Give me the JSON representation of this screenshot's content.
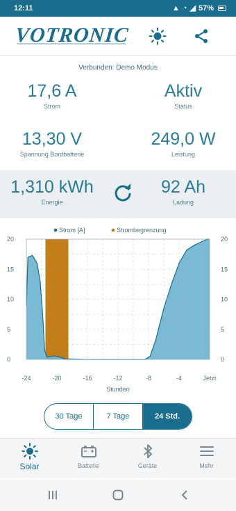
{
  "status_bar": {
    "time": "12:11",
    "battery": "57%"
  },
  "header": {
    "brand": "VOTRONIC"
  },
  "connection_text": "Verbunden: Demo Modus",
  "metrics": {
    "strom": {
      "value": "17,6 A",
      "label": "Strom"
    },
    "status": {
      "value": "Aktiv",
      "label": "Status"
    },
    "spannung": {
      "value": "13,30 V",
      "label": "Spannung Bordbatterie"
    },
    "leistung": {
      "value": "249,0 W",
      "label": "Leistung"
    },
    "energie": {
      "value": "1,310 kWh",
      "label": "Energie"
    },
    "ladung": {
      "value": "92 Ah",
      "label": "Ladung"
    }
  },
  "chart_data": {
    "type": "area",
    "legend": [
      {
        "name": "Strom [A]",
        "color": "#1a6d8d"
      },
      {
        "name": "Strombegrenzung",
        "color": "#c17d1a"
      }
    ],
    "xlabel": "Stunden",
    "x_ticks": [
      "-24",
      "-20",
      "-16",
      "-12",
      "-8",
      "-4",
      "Jetzt"
    ],
    "y_ticks": [
      "0",
      "5",
      "10",
      "15",
      "20"
    ],
    "ylim": [
      0,
      20
    ],
    "xlim": [
      -24,
      0
    ],
    "series": [
      {
        "name": "Strom [A]",
        "color": "#6db3cf",
        "points": [
          [
            -24,
            9
          ],
          [
            -23.8,
            17
          ],
          [
            -23.2,
            17.3
          ],
          [
            -22.6,
            16
          ],
          [
            -22.2,
            13
          ],
          [
            -21.9,
            8
          ],
          [
            -21.6,
            1.5
          ],
          [
            -21.3,
            0.4
          ],
          [
            -20.8,
            0.5
          ],
          [
            -20.3,
            0.6
          ],
          [
            -19.6,
            0.4
          ],
          [
            -19,
            0.1
          ],
          [
            -16,
            0
          ],
          [
            -12,
            0
          ],
          [
            -8.5,
            0
          ],
          [
            -7.8,
            0.5
          ],
          [
            -7,
            3.5
          ],
          [
            -6,
            8.5
          ],
          [
            -5,
            12.5
          ],
          [
            -4,
            16
          ],
          [
            -3,
            18.2
          ],
          [
            -2,
            19
          ],
          [
            -1,
            19.6
          ],
          [
            -0.3,
            20
          ],
          [
            0,
            20
          ]
        ]
      },
      {
        "name": "Strombegrenzung",
        "color": "#c17d1a",
        "range": [
          -21.5,
          -18.5
        ],
        "value": 20
      }
    ]
  },
  "range_selector": {
    "options": [
      "30 Tage",
      "7 Tage",
      "24 Std."
    ],
    "selected": "24 Std."
  },
  "bottom_nav": {
    "items": [
      "Solar",
      "Batterie",
      "Geräte",
      "Mehr"
    ],
    "active": "Solar"
  }
}
